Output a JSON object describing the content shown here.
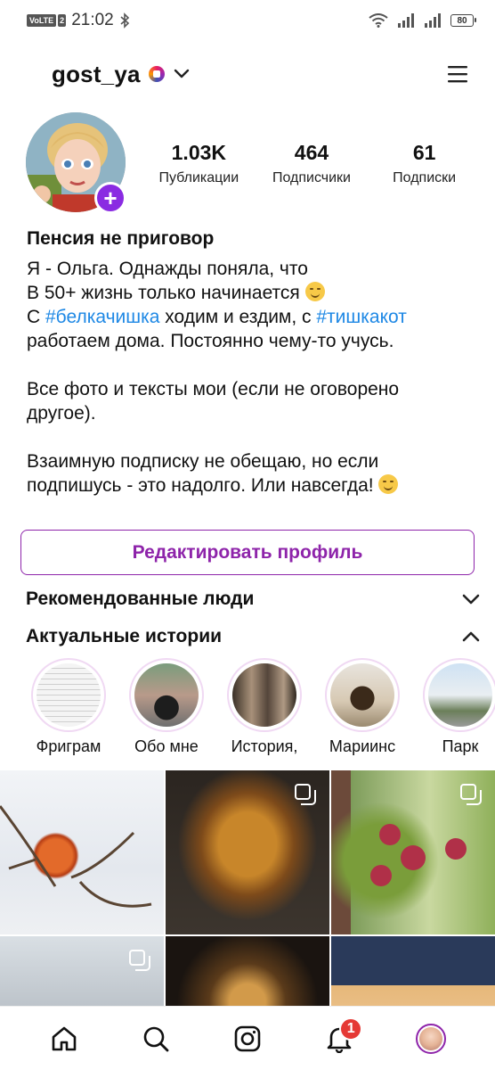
{
  "status_bar": {
    "network_badge": "VoLTE",
    "sim_badge": "2",
    "time": "21:02",
    "battery": "80"
  },
  "header": {
    "username": "gost_ya"
  },
  "stats": [
    {
      "value": "1.03K",
      "label": "Публикации"
    },
    {
      "value": "464",
      "label": "Подписчики"
    },
    {
      "value": "61",
      "label": "Подписки"
    }
  ],
  "bio": {
    "name": "Пенсия не приговор",
    "l1": "Я - Ольга. Однажды поняла, что",
    "l2": "В 50+ жизнь только начинается",
    "l3a": "С ",
    "l3tag1": "#белкачишка",
    "l3b": " ходим и ездим, с ",
    "l3tag2": "#тишкакот",
    "l4": "работаем дома. Постоянно чему-то учусь.",
    "l5": "Все фото и тексты мои (если не оговорено",
    "l6": "другое).",
    "l7": "Взаимную подписку не обещаю, но если",
    "l8": "подпишусь - это надолго. Или навсегда!"
  },
  "edit_button": "Редактировать профиль",
  "sections": {
    "recommended": "Рекомендованные люди",
    "highlights": "Актуальные истории"
  },
  "highlights": [
    {
      "label": "Фриграм"
    },
    {
      "label": "Обо мне"
    },
    {
      "label": "История,"
    },
    {
      "label": "Мариинс"
    },
    {
      "label": "Парк"
    }
  ],
  "nav": {
    "notification_count": "1"
  },
  "icons": [
    "chevron-down-icon",
    "menu-icon",
    "home-icon",
    "search-icon",
    "camera-icon",
    "bell-icon",
    "multi-post-icon"
  ],
  "colors": {
    "accent": "#8e24aa",
    "hashtag": "#1e88e5",
    "badge": "#e53935"
  }
}
